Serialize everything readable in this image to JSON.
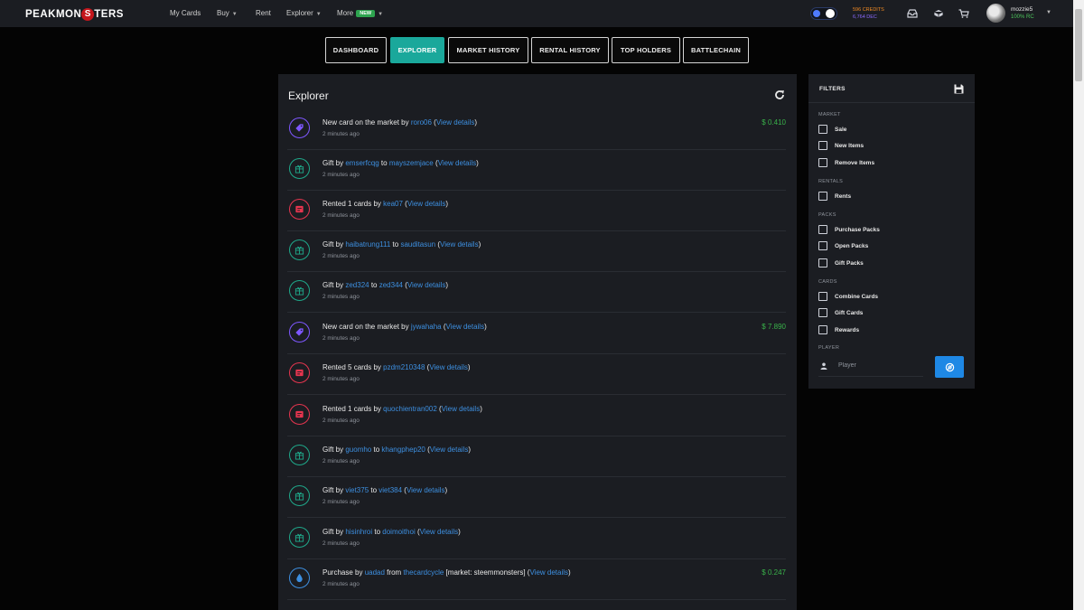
{
  "nav": {
    "logo_left": "PEAKMON",
    "logo_o": "S",
    "logo_right": "TERS",
    "links": [
      {
        "label": "My Cards"
      },
      {
        "label": "Buy"
      },
      {
        "label": "Rent"
      },
      {
        "label": "Explorer"
      },
      {
        "label": "More"
      }
    ],
    "new_badge": "NEW",
    "credits_line1": "596 CREDITS",
    "credits_line2": "6,764 DEC",
    "username": "mozzie5",
    "user_rc": "100% RC"
  },
  "tabs": [
    {
      "label": "DASHBOARD"
    },
    {
      "label": "EXPLORER"
    },
    {
      "label": "MARKET HISTORY"
    },
    {
      "label": "RENTAL HISTORY"
    },
    {
      "label": "TOP HOLDERS"
    },
    {
      "label": "BATTLECHAIN"
    }
  ],
  "explorer": {
    "title": "Explorer",
    "rows": [
      {
        "p1": "New card on the market by ",
        "l1": "roro06",
        "p2": " (",
        "l2": "View details",
        "p3": ")",
        "time": "2 minutes ago",
        "price": "$ 0.410"
      },
      {
        "p1": "Gift by ",
        "l1": "emserfcqg",
        "p2": " to ",
        "l2": "mayszemjace",
        "p3": " (",
        "l3": "View details",
        "p4": ")",
        "time": "2 minutes ago"
      },
      {
        "p1": "Rented 1 cards by ",
        "l1": "kea07",
        "p2": " (",
        "l2": "View details",
        "p3": ")",
        "time": "2 minutes ago"
      },
      {
        "p1": "Gift by ",
        "l1": "haibatrung111",
        "p2": " to ",
        "l2": "sauditasun",
        "p3": " (",
        "l3": "View details",
        "p4": ")",
        "time": "2 minutes ago"
      },
      {
        "p1": "Gift by ",
        "l1": "zed324",
        "p2": " to ",
        "l2": "zed344",
        "p3": " (",
        "l3": "View details",
        "p4": ")",
        "time": "2 minutes ago"
      },
      {
        "p1": "New card on the market by ",
        "l1": "jywahaha",
        "p2": " (",
        "l2": "View details",
        "p3": ")",
        "time": "2 minutes ago",
        "price": "$ 7.890"
      },
      {
        "p1": "Rented 5 cards by ",
        "l1": "pzdm210348",
        "p2": " (",
        "l2": "View details",
        "p3": ")",
        "time": "2 minutes ago"
      },
      {
        "p1": "Rented 1 cards by ",
        "l1": "quochientran002",
        "p2": " (",
        "l2": "View details",
        "p3": ")",
        "time": "2 minutes ago"
      },
      {
        "p1": "Gift by ",
        "l1": "guomho",
        "p2": " to ",
        "l2": "khangphep20",
        "p3": " (",
        "l3": "View details",
        "p4": ")",
        "time": "2 minutes ago"
      },
      {
        "p1": "Gift by ",
        "l1": "viet375",
        "p2": " to ",
        "l2": "viet384",
        "p3": " (",
        "l3": "View details",
        "p4": ")",
        "time": "2 minutes ago"
      },
      {
        "p1": "Gift by ",
        "l1": "hisinhroi",
        "p2": " to ",
        "l2": "doimoithoi",
        "p3": " (",
        "l3": "View details",
        "p4": ")",
        "time": "2 minutes ago"
      },
      {
        "p1": "Purchase by ",
        "l1": "uadad",
        "p2": " from ",
        "l2": "thecardcycle",
        "p3": " [market: steemmonsters] (",
        "l3": "View details",
        "p4": ")",
        "time": "2 minutes ago",
        "price": "$ 0.247"
      }
    ]
  },
  "filters": {
    "title": "FILTERS",
    "sections": {
      "market": "MARKET",
      "rentals": "RENTALS",
      "packs": "PACKS",
      "cards": "CARDS",
      "player": "PLAYER"
    },
    "options": {
      "sale": "Sale",
      "new_items": "New Items",
      "remove_items": "Remove Items",
      "rents": "Rents",
      "purchase_packs": "Purchase Packs",
      "open_packs": "Open Packs",
      "gift_packs": "Gift Packs",
      "combine_cards": "Combine Cards",
      "gift_cards": "Gift Cards",
      "rewards": "Rewards"
    },
    "player_placeholder": "Player"
  },
  "colors": {
    "accent_tab": "#1aa89b",
    "market_icon": "#7e57ff",
    "gift_icon": "#1fa88a",
    "rent_icon": "#e5354f",
    "purchase_icon": "#3d8fe0",
    "price": "#39b24a",
    "link": "#3d8fe0"
  }
}
